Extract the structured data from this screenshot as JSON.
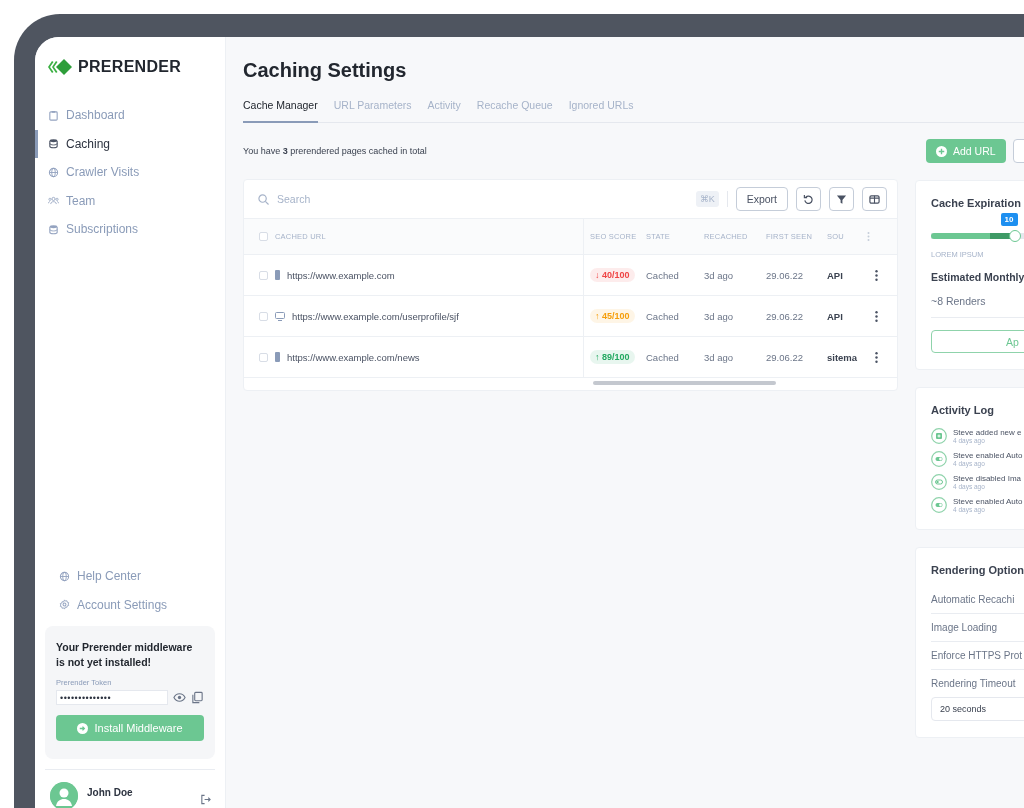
{
  "sidebar": {
    "logo": "PRERENDER",
    "nav": [
      {
        "label": "Dashboard",
        "kind": "clipboard",
        "selected": false
      },
      {
        "label": "Caching",
        "kind": "database",
        "selected": true
      },
      {
        "label": "Crawler Visits",
        "kind": "globe",
        "selected": false
      },
      {
        "label": "Team",
        "kind": "people",
        "selected": false
      },
      {
        "label": "Subscriptions",
        "kind": "database",
        "selected": false
      }
    ],
    "bottom_nav": [
      {
        "label": "Help Center",
        "kind": "globe"
      },
      {
        "label": "Account Settings",
        "kind": "gear"
      }
    ],
    "notice": {
      "message": "Your Prerender middleware is not yet installed!",
      "token_label": "Prerender Token",
      "token_value": "••••••••••••••",
      "button": "Install Middleware"
    },
    "user": {
      "name": "John Doe"
    }
  },
  "page": {
    "title": "Caching Settings",
    "tabs": [
      {
        "label": "Cache Manager",
        "selected": true
      },
      {
        "label": "URL Parameters",
        "selected": false
      },
      {
        "label": "Activity",
        "selected": false
      },
      {
        "label": "Recache Queue",
        "selected": false
      },
      {
        "label": "Ignored URLs",
        "selected": false
      }
    ],
    "summary": "You have **3** prerendered pages cached in total",
    "add_button": "Add URL"
  },
  "table": {
    "search": {
      "placeholder": "Search",
      "shortcut": "⌘K"
    },
    "export_button": "Export",
    "header_checked": false,
    "columns": [
      "CACHED URL",
      "SEO SCORE",
      "STATE",
      "RECACHED",
      "FIRST SEEN",
      "SOU"
    ],
    "rows": [
      {
        "checked": false,
        "kind": "mobile",
        "url": "https://www.example.com",
        "score": "↓ 40/100",
        "color": "#ef4444",
        "state": "Cached",
        "recached": "3d ago",
        "first_seen": "29.06.22",
        "source": "API"
      },
      {
        "checked": false,
        "kind": "desktop",
        "url": "https://www.example.com/userprofile/sjf",
        "score": "↑ 45/100",
        "color": "#f59e0b",
        "state": "Cached",
        "recached": "3d ago",
        "first_seen": "29.06.22",
        "source": "API"
      },
      {
        "checked": false,
        "kind": "mobile",
        "url": "https://www.example.com/news",
        "score": "↑ 89/100",
        "color": "#22a860",
        "state": "Cached",
        "recached": "3d ago",
        "first_seen": "29.06.22",
        "source": "sitema"
      }
    ]
  },
  "cache_expiration": {
    "title": "Cache Expiration",
    "tooltip": "10",
    "level": 0.38,
    "slider_label": "LOREM IPSUM",
    "estimate_title": "Estimated Monthly",
    "estimate_value": "~8 Renders",
    "button": "Ap"
  },
  "activity_log": {
    "title": "Activity Log",
    "items": [
      {
        "kind": "added",
        "text": "Steve added new e",
        "time": "4 days ago"
      },
      {
        "kind": "enabled",
        "text": "Steve enabled Auto",
        "time": "4 days ago"
      },
      {
        "kind": "disabled",
        "text": "Steve disabled Ima",
        "time": "4 days ago"
      },
      {
        "kind": "enabled",
        "text": "Steve enabled Auto",
        "time": "4 days ago"
      }
    ]
  },
  "rendering_options": {
    "title": "Rendering Option",
    "rows": [
      "Automatic Recachi",
      "Image Loading",
      "Enforce HTTPS Prot",
      "Rendering Timeout"
    ],
    "timeout_value": "20 seconds"
  }
}
